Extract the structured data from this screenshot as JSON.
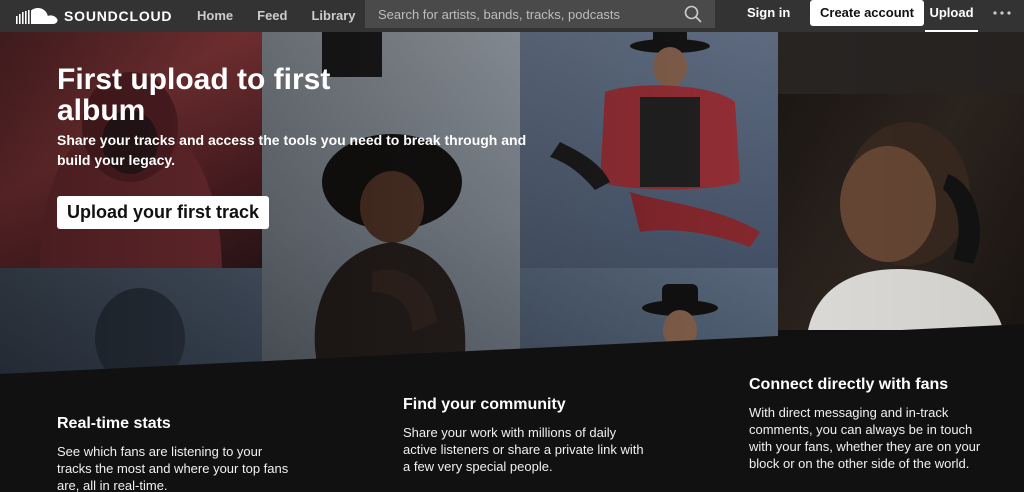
{
  "header": {
    "brand": "SOUNDCLOUD",
    "nav": [
      "Home",
      "Feed",
      "Library"
    ],
    "search_placeholder": "Search for artists, bands, tracks, podcasts",
    "signin_label": "Sign in",
    "create_account_label": "Create account",
    "upload_label": "Upload",
    "icons": {
      "logo": "soundcloud-cloud-icon",
      "search": "search-icon",
      "more": "more-dots-icon"
    }
  },
  "hero": {
    "title": "First upload to first album",
    "subtitle": "Share your tracks and access the tools you need to break through and build your legacy.",
    "cta_label": "Upload your first track"
  },
  "features": [
    {
      "title": "Real-time stats",
      "text": "See which fans are listening to your tracks the most and where your top fans are, all in real-time."
    },
    {
      "title": "Find your community",
      "text": "Share your work with millions of daily active listeners or share a private link with a few very special people."
    },
    {
      "title": "Connect directly with fans",
      "text": "With direct messaging and in-track comments, you can always be in touch with your fans, whether they are on your block or on the other side of the world."
    }
  ],
  "colors": {
    "topbar": "#333333",
    "page_bg": "#111111",
    "button_bg": "#ffffff",
    "text": "#ffffff"
  }
}
